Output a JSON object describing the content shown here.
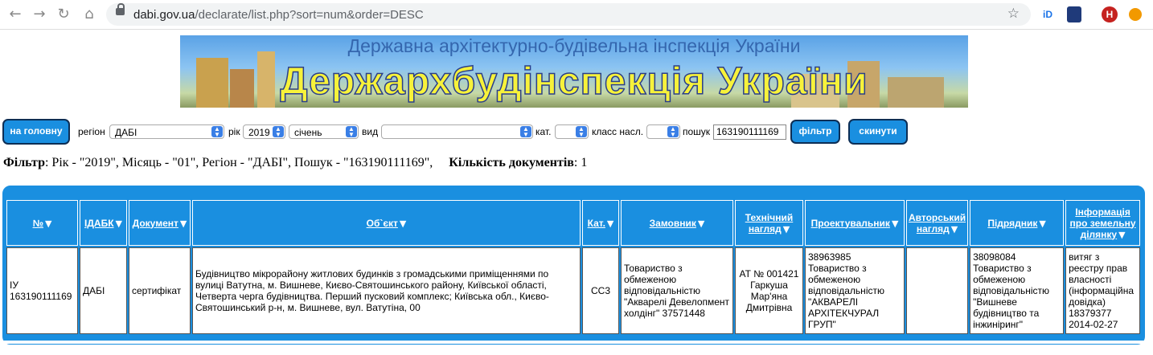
{
  "browser": {
    "url_domain": "dabi.gov.ua",
    "url_path": "/declarate/list.php?sort=num&order=DESC",
    "ext1": "iD",
    "profile": "H"
  },
  "banner": {
    "line1": "Державна архітектурно-будівельна інспекція України",
    "line2": "Держархбудінспекція України"
  },
  "filters": {
    "home_button": "на головну",
    "region_label": "регіон",
    "region_value": "ДАБІ",
    "year_label": "рік",
    "year_value": "2019",
    "month_value": "січень",
    "type_label": "вид",
    "type_value": "",
    "cat_label": "кат.",
    "cat_value": "",
    "class_label": "класс насл.",
    "class_value": "",
    "search_label": "пошук",
    "search_value": "163190111169",
    "filter_button": "фільтр",
    "reset_button": "скинути"
  },
  "summary": {
    "filter_label": "Фільтр",
    "filter_text": ": Рік - \"2019\", Місяць - \"01\", Регіон - \"ДАБІ\", Пошук - \"163190111169\",",
    "count_label": "Кількість документів",
    "count_value": ": 1"
  },
  "table": {
    "headers": [
      "№",
      "ІДАБК",
      "Документ",
      "Об`єкт",
      "Кат.",
      "Замовник",
      "Технічний нагляд",
      "Проектувальник",
      "Авторський нагляд",
      "Підрядник",
      "Інформація про земельну ділянку"
    ],
    "rows": [
      [
        "ІУ 163190111169",
        "ДАБІ",
        "сертифікат",
        "Будівництво мікрорайону житлових будинків з громадськими приміщеннями по вулиці Ватутна, м. Вишневе, Києво-Святошинського району, Київської області, Четверта черга будівництва. Перший пусковий комплекс; Київська обл., Києво-Святошинський р-н, м. Вишневе, вул. Ватутіна, 00",
        "СС3",
        "Товариство з обмеженою відповідальністю \"Акварелі Девелопмент холдінг\" 37571448",
        "АТ № 001421 Гаркуша Мар'яна Дмитрівна",
        "38963985 Товариство з обмеженою відповідальністю \"АКВАРЕЛІ АРХІТЕКЧУРАЛ ГРУП\"",
        "",
        "38098084 Товариство з обмеженою відповідальністю \"Вишневе будівництво та інжиніринг\"",
        "витяг з реєстру прав власності (інформаційна довідка) 18379377 2014-02-27"
      ]
    ]
  }
}
